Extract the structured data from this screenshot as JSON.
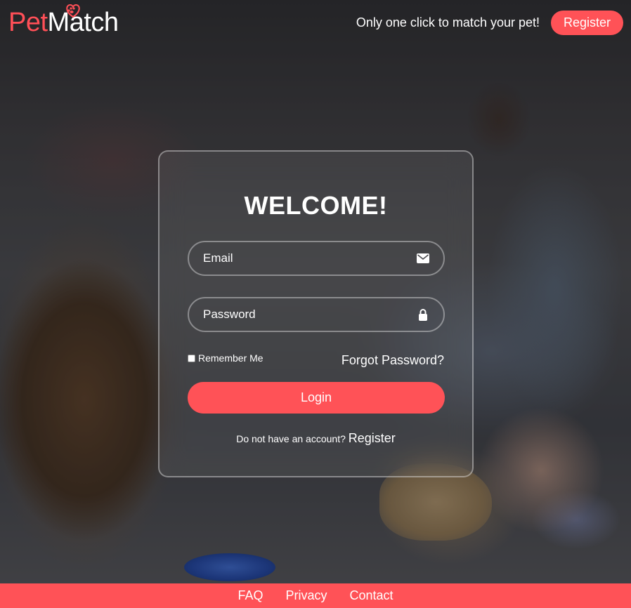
{
  "header": {
    "logo_pet": "Pet",
    "logo_match": "Match",
    "tagline": "Only one click to match your pet!",
    "register_label": "Register"
  },
  "login_card": {
    "title": "WELCOME!",
    "email_placeholder": "Email",
    "password_placeholder": "Password",
    "remember_label": "Remember Me",
    "forgot_label": "Forgot Password?",
    "login_label": "Login",
    "no_account_text": "Do not have an account? ",
    "register_link": "Register"
  },
  "footer": {
    "links": [
      "FAQ",
      "Privacy",
      "Contact"
    ]
  },
  "colors": {
    "accent": "#ff5257",
    "text": "#ffffff"
  },
  "icons": {
    "email": "envelope-icon",
    "password": "lock-icon",
    "logo": "heart-paw-icon"
  }
}
